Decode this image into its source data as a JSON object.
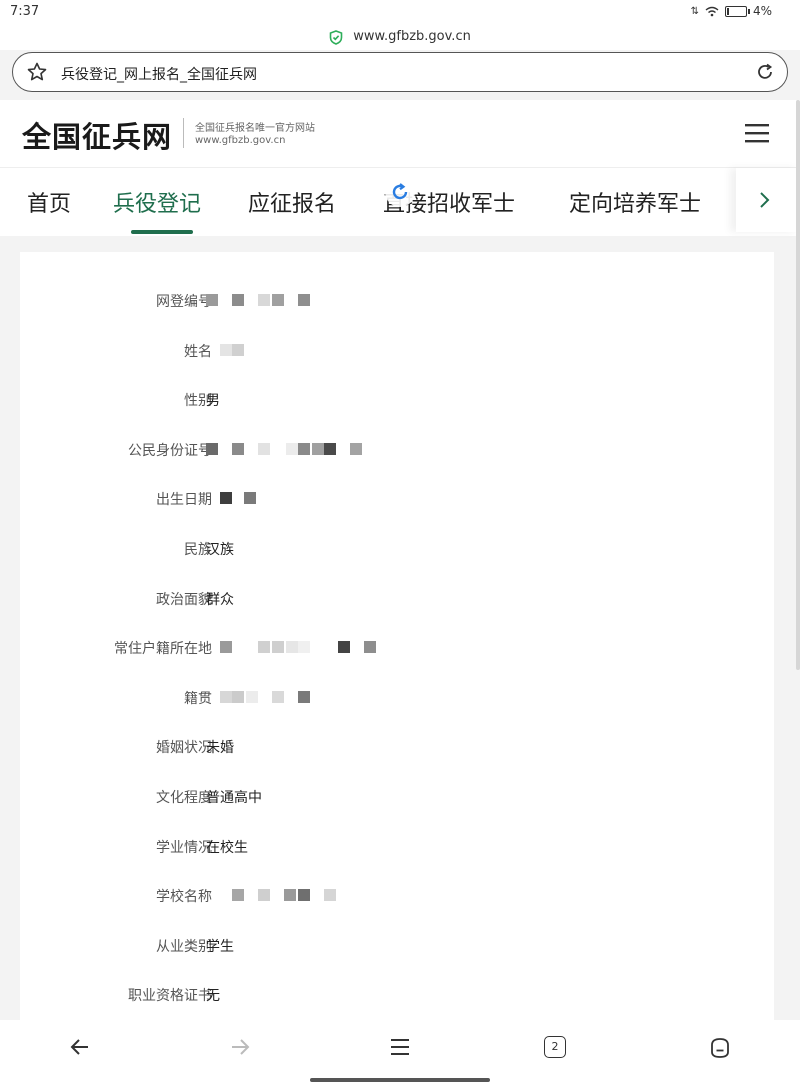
{
  "status": {
    "time": "7:37",
    "battery": "4%",
    "battery_level": 0.04
  },
  "browser": {
    "host": "www.gfbzb.gov.cn",
    "tab_title": "兵役登记_网上报名_全国征兵网"
  },
  "site": {
    "logo": "全国征兵网",
    "tagline": "全国征兵报名唯一官方网站",
    "url": "www.gfbzb.gov.cn"
  },
  "nav": {
    "tabs": [
      {
        "label": "首页"
      },
      {
        "label": "兵役登记"
      },
      {
        "label": "应征报名"
      },
      {
        "label": "直接招收军士"
      },
      {
        "label": "定向培养军士"
      }
    ],
    "active_index": 1
  },
  "form": {
    "rows": [
      {
        "label": "网登编号",
        "value": ""
      },
      {
        "label": "姓名",
        "value": ""
      },
      {
        "label": "性别",
        "value": "男"
      },
      {
        "label": "公民身份证号",
        "value": ""
      },
      {
        "label": "出生日期",
        "value": ""
      },
      {
        "label": "民族",
        "value": "汉族"
      },
      {
        "label": "政治面貌",
        "value": "群众"
      },
      {
        "label": "常住户籍所在地",
        "value": ""
      },
      {
        "label": "籍贯",
        "value": ""
      },
      {
        "label": "婚姻状况",
        "value": "未婚"
      },
      {
        "label": "文化程度",
        "value": "普通高中"
      },
      {
        "label": "学业情况",
        "value": "在校生"
      },
      {
        "label": "学校名称",
        "value": ""
      },
      {
        "label": "从业类别",
        "value": "学生"
      },
      {
        "label": "职业资格证书",
        "value": "无"
      }
    ]
  },
  "toolbar": {
    "tab_count": "2"
  },
  "colors": {
    "accent": "#1f6e4d",
    "shield": "#2eae5a"
  }
}
